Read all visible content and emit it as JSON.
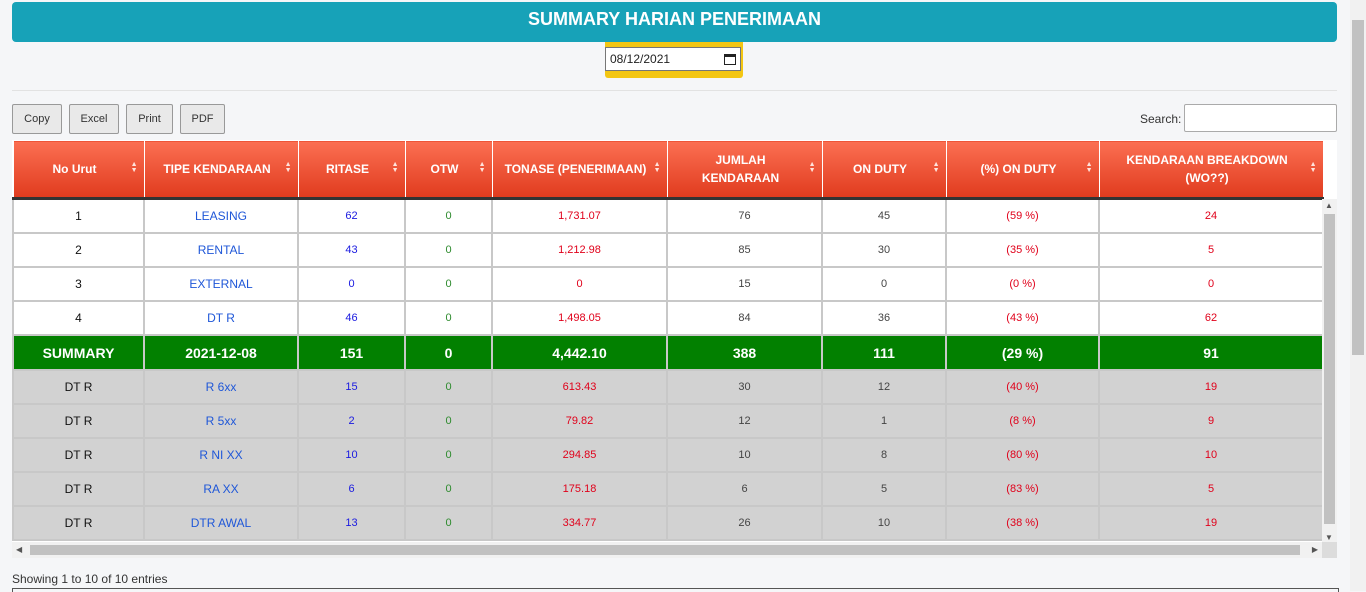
{
  "header": {
    "title": "SUMMARY HARIAN PENERIMAAN"
  },
  "date_filter": {
    "value": "08/12/2021"
  },
  "toolbar": {
    "copy": "Copy",
    "excel": "Excel",
    "print": "Print",
    "pdf": "PDF"
  },
  "search": {
    "label": "Search:",
    "value": ""
  },
  "table": {
    "columns": [
      "No Urut",
      "TIPE KENDARAAN",
      "RITASE",
      "OTW",
      "TONASE (PENERIMAAN)",
      "JUMLAH KENDARAAN",
      "ON DUTY",
      "(%) ON DUTY",
      "KENDARAAN BREAKDOWN (WO??)"
    ],
    "rows": [
      [
        "1",
        "LEASING",
        "62",
        "0",
        "1,731.07",
        "76",
        "45",
        "(59 %)",
        "24"
      ],
      [
        "2",
        "RENTAL",
        "43",
        "0",
        "1,212.98",
        "85",
        "30",
        "(35 %)",
        "5"
      ],
      [
        "3",
        "EXTERNAL",
        "0",
        "0",
        "0",
        "15",
        "0",
        "(0 %)",
        "0"
      ],
      [
        "4",
        "DT R",
        "46",
        "0",
        "1,498.05",
        "84",
        "36",
        "(43 %)",
        "62"
      ]
    ],
    "summary": [
      "SUMMARY",
      "2021-12-08",
      "151",
      "0",
      "4,442.10",
      "388",
      "111",
      "(29 %)",
      "91"
    ],
    "detail_rows": [
      [
        "DT R",
        "R 6xx",
        "15",
        "0",
        "613.43",
        "30",
        "12",
        "(40 %)",
        "19"
      ],
      [
        "DT R",
        "R 5xx",
        "2",
        "0",
        "79.82",
        "12",
        "1",
        "(8 %)",
        "9"
      ],
      [
        "DT R",
        "R NI XX",
        "10",
        "0",
        "294.85",
        "10",
        "8",
        "(80 %)",
        "10"
      ],
      [
        "DT R",
        "RA XX",
        "6",
        "0",
        "175.18",
        "6",
        "5",
        "(83 %)",
        "5"
      ],
      [
        "DT R",
        "DTR AWAL",
        "13",
        "0",
        "334.77",
        "26",
        "10",
        "(38 %)",
        "19"
      ]
    ]
  },
  "footer": {
    "info": "Showing 1 to 10 of 10 entries"
  },
  "colors": {
    "header_bg": "#17a2b8",
    "table_head": "#e84a2c",
    "summary_row": "#028000",
    "detail_row": "#d2d2d2",
    "date_accent": "#f3c613"
  }
}
